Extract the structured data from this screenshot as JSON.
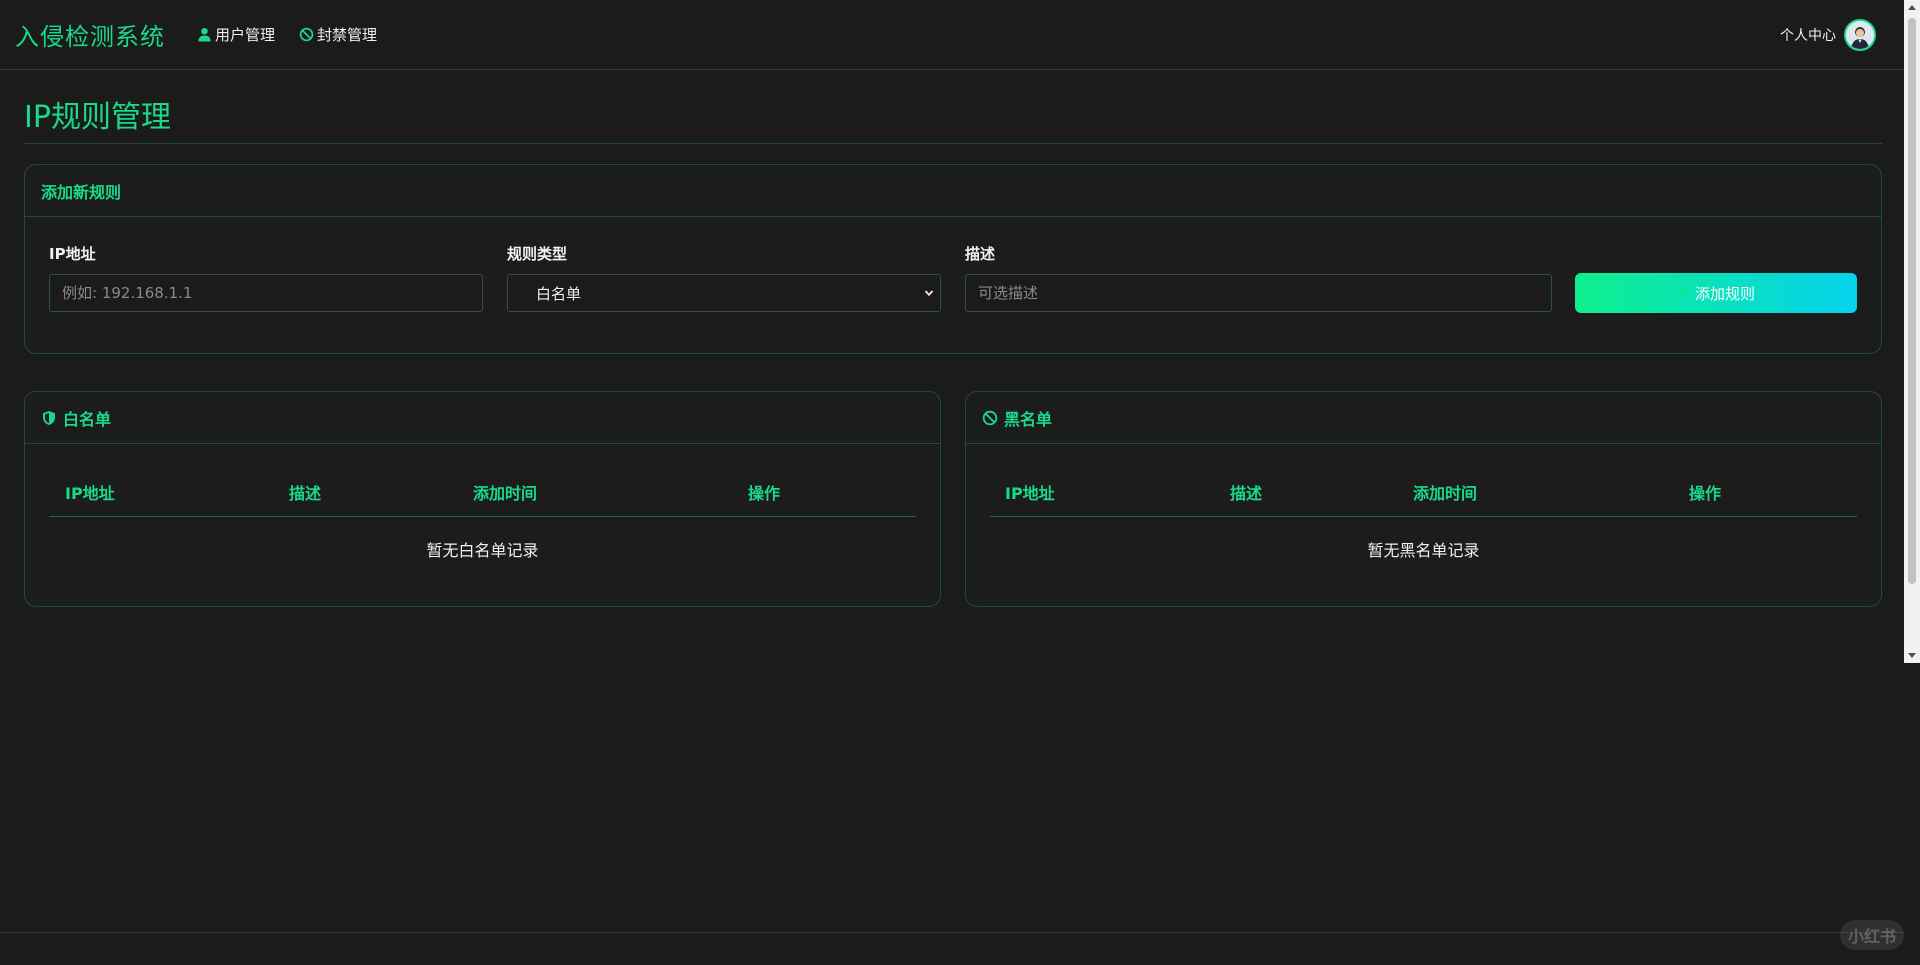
{
  "navbar": {
    "brand": "入侵检测系统",
    "links": [
      {
        "label": "用户管理",
        "icon": "user-icon"
      },
      {
        "label": "封禁管理",
        "icon": "ban-icon"
      }
    ],
    "user_label": "个人中心"
  },
  "page": {
    "title": "IP规则管理"
  },
  "add_rule": {
    "header": "添加新规则",
    "ip_label": "IP地址",
    "ip_placeholder": "例如: 192.168.1.1",
    "type_label": "规则类型",
    "type_value": "白名单",
    "desc_label": "描述",
    "desc_placeholder": "可选描述",
    "submit_label": "添加规则"
  },
  "whitelist": {
    "header": "白名单",
    "icon": "shield-icon",
    "columns": [
      "IP地址",
      "描述",
      "添加时间",
      "操作"
    ],
    "empty_text": "暂无白名单记录"
  },
  "blacklist": {
    "header": "黑名单",
    "icon": "ban-icon",
    "columns": [
      "IP地址",
      "描述",
      "添加时间",
      "操作"
    ],
    "empty_text": "暂无黑名单记录"
  },
  "watermark": "小红书",
  "colors": {
    "accent": "#19d98a",
    "background": "#1b1b1b",
    "border": "#1e4c3c",
    "button_gradient_start": "#0ef08c",
    "button_gradient_end": "#05d2ee"
  }
}
